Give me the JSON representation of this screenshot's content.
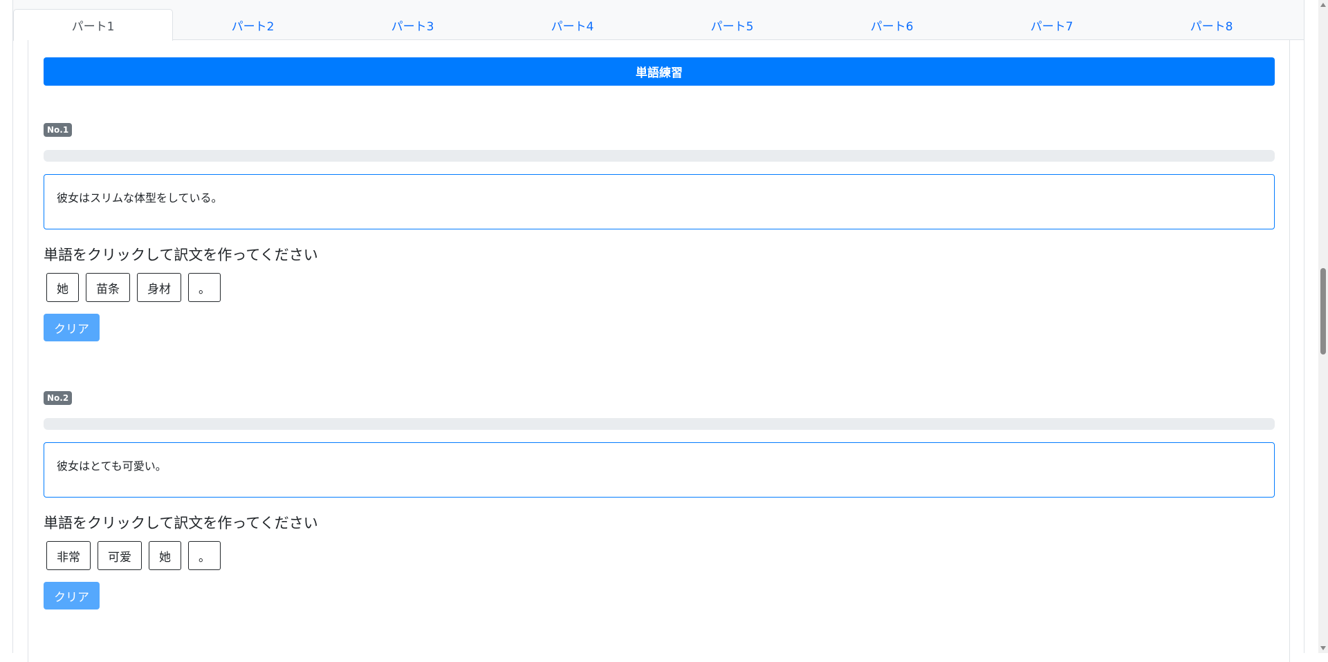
{
  "tabs": [
    {
      "label": "パート1",
      "active": true
    },
    {
      "label": "パート2",
      "active": false
    },
    {
      "label": "パート3",
      "active": false
    },
    {
      "label": "パート4",
      "active": false
    },
    {
      "label": "パート5",
      "active": false
    },
    {
      "label": "パート6",
      "active": false
    },
    {
      "label": "パート7",
      "active": false
    },
    {
      "label": "パート8",
      "active": false
    }
  ],
  "header": {
    "title": "単語練習"
  },
  "questions": [
    {
      "badge": "No.1",
      "progress": 0,
      "sentence": "彼女はスリムな体型をしている。",
      "instruction": "単語をクリックして訳文を作ってください",
      "words": [
        "她",
        "苗条",
        "身材",
        "。"
      ],
      "clear_label": "クリア"
    },
    {
      "badge": "No.2",
      "progress": 0,
      "sentence": "彼女はとても可愛い。",
      "instruction": "単語をクリックして訳文を作ってください",
      "words": [
        "非常",
        "可爱",
        "她",
        "。"
      ],
      "clear_label": "クリア"
    }
  ],
  "colors": {
    "primary": "#007bff",
    "tab_link": "#0d6efd",
    "badge": "#6c757d",
    "clear_button": "#55a8fd",
    "progress_track": "#e9ecef"
  }
}
